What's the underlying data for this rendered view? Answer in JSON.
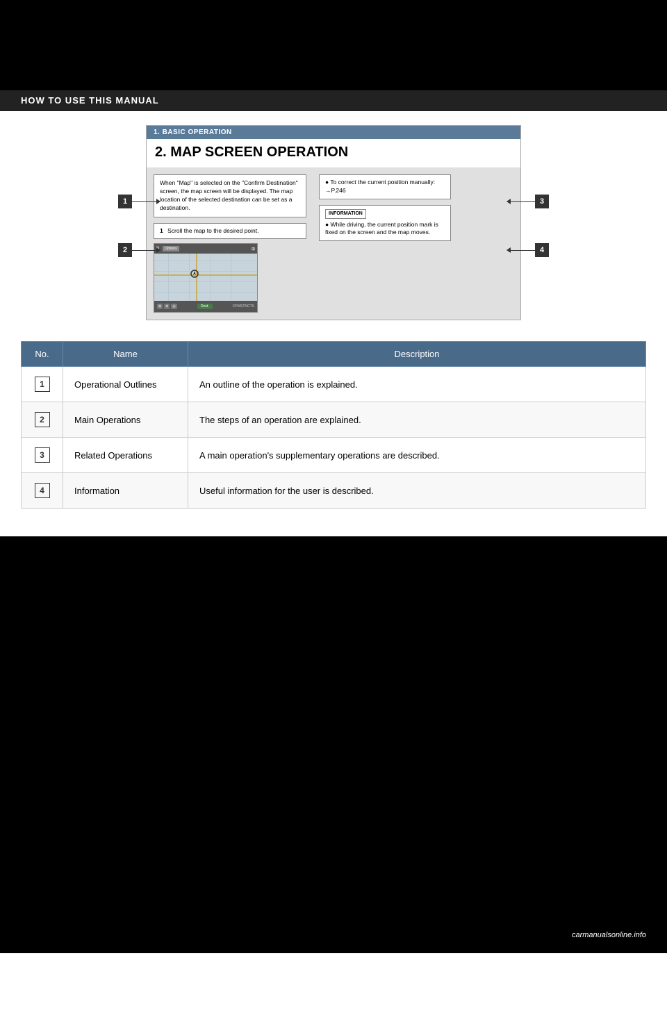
{
  "page": {
    "section_header": "HOW TO USE THIS MANUAL",
    "background": "#000"
  },
  "doc_preview": {
    "header": "1. BASIC OPERATION",
    "title": "2. MAP SCREEN OPERATION",
    "outline_text": "When \"Map\" is selected on the \"Confirm Destination\" screen, the map screen will be displayed. The map location of the selected destination can be set as a destination.",
    "step_text": "Scroll the map to the desired point.",
    "step_num": "1",
    "related_text": "● To correct the current position manually: →P.246",
    "info_label": "INFORMATION",
    "info_text": "● While driving, the current position mark is fixed on the screen and the map moves."
  },
  "left_labels": [
    "1",
    "2"
  ],
  "right_labels": [
    "3",
    "4"
  ],
  "table": {
    "headers": [
      "No.",
      "Name",
      "Description"
    ],
    "rows": [
      {
        "no": "1",
        "name": "Operational Outlines",
        "description": "An outline of the operation is explained."
      },
      {
        "no": "2",
        "name": "Main Operations",
        "description": "The steps of an operation are explained."
      },
      {
        "no": "3",
        "name": "Related Operations",
        "description": "A main operation's supplementary operations are described."
      },
      {
        "no": "4",
        "name": "Information",
        "description": "Useful information for the user is described."
      }
    ]
  },
  "bottom_logo": "carmanualsonline.info"
}
